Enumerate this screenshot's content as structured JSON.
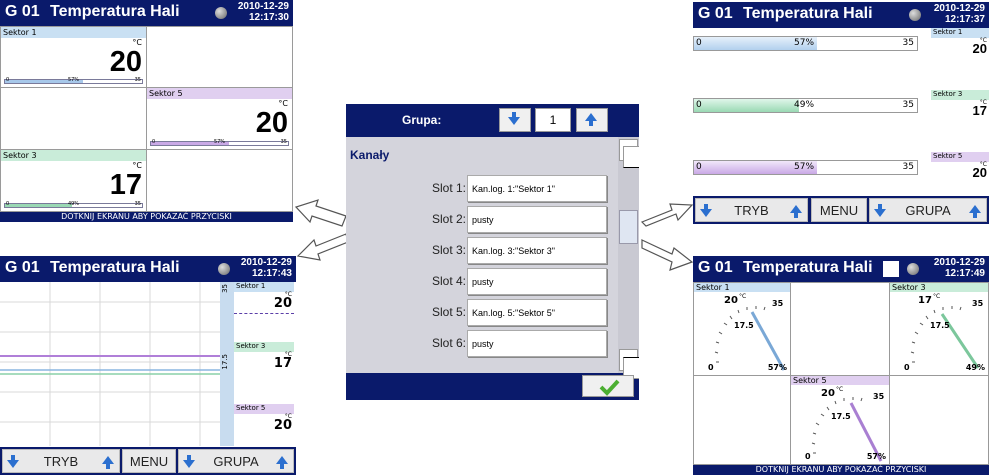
{
  "colors": {
    "title_bar": "#0a1a6b",
    "sektor1": "#c9e0f3",
    "sektor3": "#c9ecd9",
    "sektor5": "#e0cff0",
    "bar1_fill": "#a7c8ea",
    "bar3_fill": "#9ad9b4",
    "bar5_fill": "#c9a9e6",
    "accent_arrow": "#2b6fcf"
  },
  "header": {
    "group": "G 01",
    "title": "Temperatura Hali"
  },
  "panel_top_left": {
    "date": "2010-12-29",
    "time": "12:17:30",
    "cells": [
      {
        "label": "Sektor 1",
        "unit": "°C",
        "value": "20",
        "pct": "57%",
        "min": "0",
        "max": "35",
        "fill": 0.57
      },
      {
        "label": "Sektor 5",
        "unit": "°C",
        "value": "20",
        "pct": "57%",
        "min": "0",
        "max": "35",
        "fill": 0.57
      },
      {
        "label": "Sektor 3",
        "unit": "°C",
        "value": "17",
        "pct": "49%",
        "min": "0",
        "max": "35",
        "fill": 0.49
      }
    ],
    "footer": "DOTKNIJ EKRANU ABY POKAZAĆ PRZYCISKI"
  },
  "panel_bottom_left": {
    "date": "2010-12-29",
    "time": "12:17:43",
    "scale_top": "35",
    "scale_mid": "17.5",
    "tags": [
      {
        "label": "Sektor 1",
        "unit": "°C",
        "value": "20"
      },
      {
        "label": "Sektor 3",
        "unit": "°C",
        "value": "17"
      },
      {
        "label": "Sektor 5",
        "unit": "°C",
        "value": "20"
      }
    ],
    "buttons": {
      "tryb": "TRYB",
      "menu": "MENU",
      "grupa": "GRUPA"
    }
  },
  "dialog": {
    "grupa_label": "Grupa:",
    "grupa_value": "1",
    "kanaly_label": "Kanały",
    "slots": [
      {
        "label": "Slot 1:",
        "value": "Kan.log. 1:\"Sektor 1\""
      },
      {
        "label": "Slot 2:",
        "value": "pusty"
      },
      {
        "label": "Slot 3:",
        "value": "Kan.log. 3:\"Sektor 3\""
      },
      {
        "label": "Slot 4:",
        "value": "pusty"
      },
      {
        "label": "Slot 5:",
        "value": "Kan.log. 5:\"Sektor 5\""
      },
      {
        "label": "Slot 6:",
        "value": "pusty"
      }
    ]
  },
  "panel_top_right": {
    "date": "2010-12-29",
    "time": "12:17:37",
    "rows": [
      {
        "label": "Sektor 1",
        "unit": "°C",
        "value": "20",
        "min": "0",
        "pct": "57%",
        "max": "35",
        "fill": 0.57
      },
      {
        "label": "Sektor 3",
        "unit": "°C",
        "value": "17",
        "min": "0",
        "pct": "49%",
        "max": "35",
        "fill": 0.49
      },
      {
        "label": "Sektor 5",
        "unit": "°C",
        "value": "20",
        "min": "0",
        "pct": "57%",
        "max": "35",
        "fill": 0.57
      }
    ],
    "buttons": {
      "tryb": "TRYB",
      "menu": "MENU",
      "grupa": "GRUPA"
    }
  },
  "panel_bottom_right": {
    "date": "2010-12-29",
    "time": "12:17:49",
    "gauges": [
      {
        "label": "Sektor 1",
        "value": "20",
        "unit": "°C",
        "max": "35",
        "mid": "17.5",
        "min": "0",
        "pct": "57%",
        "fill": 0.57
      },
      {
        "label": "Sektor 3",
        "value": "17",
        "unit": "°C",
        "max": "35",
        "mid": "17.5",
        "min": "0",
        "pct": "49%",
        "fill": 0.49
      },
      {
        "label": "Sektor 5",
        "value": "20",
        "unit": "°C",
        "max": "35",
        "mid": "17.5",
        "min": "0",
        "pct": "57%",
        "fill": 0.57
      }
    ],
    "footer": "DOTKNIJ EKRANU ABY POKAZAĆ PRZYCISKI"
  }
}
